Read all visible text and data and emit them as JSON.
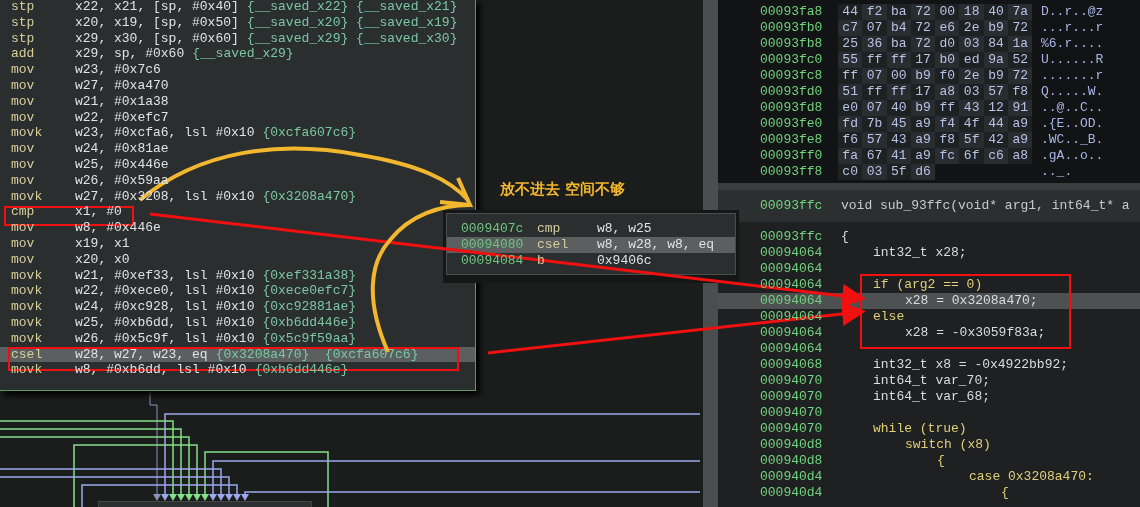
{
  "graph": {
    "block": {
      "lines": [
        {
          "op": "stp",
          "args": "x22, x21, [sp, #0x40]",
          "refs": "{__saved_x22} {__saved_x21}",
          "selected": false
        },
        {
          "op": "stp",
          "args": "x20, x19, [sp, #0x50]",
          "refs": "{__saved_x20} {__saved_x19}",
          "selected": false
        },
        {
          "op": "stp",
          "args": "x29, x30, [sp, #0x60]",
          "refs": "{__saved_x29} {__saved_x30}",
          "selected": false
        },
        {
          "op": "add",
          "args": "x29, sp, #0x60",
          "refs": "{__saved_x29}",
          "selected": false
        },
        {
          "op": "mov",
          "args": "w23, #0x7c6",
          "selected": false
        },
        {
          "op": "mov",
          "args": "w27, #0xa470",
          "selected": false
        },
        {
          "op": "mov",
          "args": "w21, #0x1a38",
          "selected": false
        },
        {
          "op": "mov",
          "args": "w22, #0xefc7",
          "selected": false
        },
        {
          "op": "movk",
          "args": "w23, #0xcfa6, lsl #0x10",
          "refs": "{0xcfa607c6}",
          "selected": false
        },
        {
          "op": "mov",
          "args": "w24, #0x81ae",
          "selected": false
        },
        {
          "op": "mov",
          "args": "w25, #0x446e",
          "selected": false
        },
        {
          "op": "mov",
          "args": "w26, #0x59aa",
          "selected": false
        },
        {
          "op": "movk",
          "args": "w27, #0x3208, lsl #0x10",
          "refs": "{0x3208a470}",
          "selected": false
        },
        {
          "op": "cmp",
          "args": "x1, #0",
          "selected": false
        },
        {
          "op": "mov",
          "args": "w8, #0x446e",
          "selected": false
        },
        {
          "op": "mov",
          "args": "x19, x1",
          "selected": false
        },
        {
          "op": "mov",
          "args": "x20, x0",
          "selected": false
        },
        {
          "op": "movk",
          "args": "w21, #0xef33, lsl #0x10",
          "refs": "{0xef331a38}",
          "selected": false
        },
        {
          "op": "movk",
          "args": "w22, #0xece0, lsl #0x10",
          "refs": "{0xece0efc7}",
          "selected": false
        },
        {
          "op": "movk",
          "args": "w24, #0xc928, lsl #0x10",
          "refs": "{0xc92881ae}",
          "selected": false
        },
        {
          "op": "movk",
          "args": "w25, #0xb6dd, lsl #0x10",
          "refs": "{0xb6dd446e}",
          "selected": false
        },
        {
          "op": "movk",
          "args": "w26, #0x5c9f, lsl #0x10",
          "refs": "{0x5c9f59aa}",
          "selected": false
        },
        {
          "op": "csel",
          "args": "w28, w27, w23, eq",
          "refs": "{0x3208a470}  {0xcfa607c6}",
          "selected": true
        },
        {
          "op": "movk",
          "args": "w8, #0xb6dd, lsl #0x10",
          "refs": "{0xb6dd446e}",
          "selected": false
        }
      ]
    },
    "annotation": "放不进去 空间不够",
    "popup": {
      "lines": [
        {
          "addr": "0009407c",
          "op": "cmp",
          "args": "w8, w25",
          "selected": false
        },
        {
          "addr": "00094080",
          "op": "csel",
          "args": "w8, w28, w8, eq",
          "selected": true
        },
        {
          "addr": "00094084",
          "op": "b",
          "args": "0x9406c",
          "selected": false
        }
      ]
    }
  },
  "hex_view": {
    "rows": [
      {
        "addr": "00093fa8",
        "bytes": [
          "44",
          "f2",
          "ba",
          "72",
          "00",
          "18",
          "40",
          "7a"
        ],
        "ascii": "D..r..@z"
      },
      {
        "addr": "00093fb0",
        "bytes": [
          "c7",
          "07",
          "b4",
          "72",
          "e6",
          "2e",
          "b9",
          "72"
        ],
        "ascii": "...r...r"
      },
      {
        "addr": "00093fb8",
        "bytes": [
          "25",
          "36",
          "ba",
          "72",
          "d0",
          "03",
          "84",
          "1a"
        ],
        "ascii": "%6.r...."
      },
      {
        "addr": "00093fc0",
        "bytes": [
          "55",
          "ff",
          "ff",
          "17",
          "b0",
          "ed",
          "9a",
          "52"
        ],
        "ascii": "U......R"
      },
      {
        "addr": "00093fc8",
        "bytes": [
          "ff",
          "07",
          "00",
          "b9",
          "f0",
          "2e",
          "b9",
          "72"
        ],
        "ascii": ".......r"
      },
      {
        "addr": "00093fd0",
        "bytes": [
          "51",
          "ff",
          "ff",
          "17",
          "a8",
          "03",
          "57",
          "f8"
        ],
        "ascii": "Q.....W."
      },
      {
        "addr": "00093fd8",
        "bytes": [
          "e0",
          "07",
          "40",
          "b9",
          "ff",
          "43",
          "12",
          "91"
        ],
        "ascii": "..@..C.."
      },
      {
        "addr": "00093fe0",
        "bytes": [
          "fd",
          "7b",
          "45",
          "a9",
          "f4",
          "4f",
          "44",
          "a9"
        ],
        "ascii": ".{E..OD."
      },
      {
        "addr": "00093fe8",
        "bytes": [
          "f6",
          "57",
          "43",
          "a9",
          "f8",
          "5f",
          "42",
          "a9"
        ],
        "ascii": ".WC.._B."
      },
      {
        "addr": "00093ff0",
        "bytes": [
          "fa",
          "67",
          "41",
          "a9",
          "fc",
          "6f",
          "c6",
          "a8"
        ],
        "ascii": ".gA..o.."
      },
      {
        "addr": "00093ff8",
        "bytes": [
          "c0",
          "03",
          "5f",
          "d6"
        ],
        "ascii": ".._."
      }
    ]
  },
  "decompiler": {
    "header": {
      "addr": "00093ffc",
      "signature": "void sub_93ffc(void* arg1, int64_t* a"
    },
    "lines": [
      {
        "addr": "00093ffc",
        "code": "{",
        "kind": "plain",
        "children": [
          {
            "addr": "00094064",
            "code": "int32_t x28;",
            "kind": "plain"
          },
          {
            "addr": "00094064",
            "kind": "blank"
          },
          {
            "addr": "00094064",
            "code": "if (arg2 == 0)",
            "kind": "keyword",
            "children": [
              {
                "addr": "00094064",
                "code": "x28 = 0x3208a470;",
                "kind": "plain",
                "selected": true
              }
            ]
          },
          {
            "addr": "00094064",
            "code": "else",
            "kind": "keyword",
            "children": [
              {
                "addr": "00094064",
                "code": "x28 = -0x3059f83a;",
                "kind": "plain"
              }
            ]
          },
          {
            "addr": "00094064",
            "kind": "blank"
          },
          {
            "addr": "00094068",
            "code": "int32_t x8 = -0x4922bb92;",
            "kind": "plain"
          },
          {
            "addr": "00094070",
            "code": "int64_t var_70;",
            "kind": "plain"
          },
          {
            "addr": "00094070",
            "code": "int64_t var_68;",
            "kind": "plain"
          },
          {
            "addr": "00094070",
            "kind": "blank"
          },
          {
            "addr": "00094070",
            "code": "while (true)",
            "kind": "keyword",
            "children": [
              {
                "addr": "000940d8",
                "code": "switch (x8)",
                "kind": "keyword",
                "children": [
                  {
                    "addr": "000940d8",
                    "code": "{",
                    "kind": "keyword",
                    "children": [
                      {
                        "addr": "000940d4",
                        "code": "case 0x3208a470:",
                        "kind": "keyword",
                        "children": [
                          {
                            "addr": "000940d4",
                            "code": "{",
                            "kind": "keyword"
                          }
                        ]
                      }
                    ]
                  }
                ]
              }
            ]
          }
        ]
      }
    ]
  }
}
